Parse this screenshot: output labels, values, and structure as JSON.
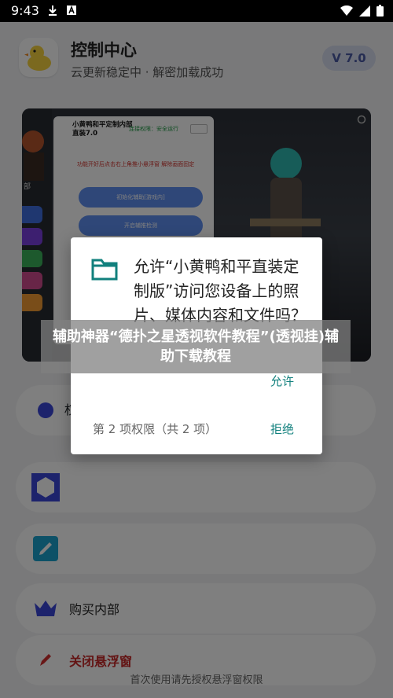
{
  "status_bar": {
    "time": "9:43"
  },
  "header": {
    "title": "控制中心",
    "subtitle": "云更新稳定中 · 解密加载成功",
    "version": "V 7.0"
  },
  "banner": {
    "panel_title": "小黄鸭和平定制内部直装7.0",
    "panel_status": "连接权限：安全运行",
    "panel_warning": "功能开好后点击右上角推小悬浮窗 解除画面固定",
    "panel_buttons": [
      "初始化辅助[游戏内]",
      "开启辅推检测",
      "",
      ""
    ],
    "side_label": "部"
  },
  "cards": [
    {
      "label": "权",
      "icon": "circle-icon"
    },
    {
      "label": "",
      "icon": "hexagon-icon"
    },
    {
      "label": "",
      "icon": "brush-icon"
    },
    {
      "label": "购买内部",
      "icon": "crown-icon"
    },
    {
      "label": "关闭悬浮窗",
      "icon": "pen-icon"
    }
  ],
  "footnote": "首次使用请先授权悬浮窗权限",
  "dialog": {
    "message": "允许“小黄鸭和平直装定制版”访问您设备上的照片、媒体内容和文件吗？",
    "allow_label": "允许",
    "count_label": "第 2 项权限（共 2 项）",
    "deny_label": "拒绝"
  },
  "caption": "辅助神器“德扑之星透视软件教程”(透视挂)辅助下载教程",
  "colors": {
    "accent": "#11807d",
    "version_bg": "#d7dcef",
    "danger": "#c62828"
  }
}
